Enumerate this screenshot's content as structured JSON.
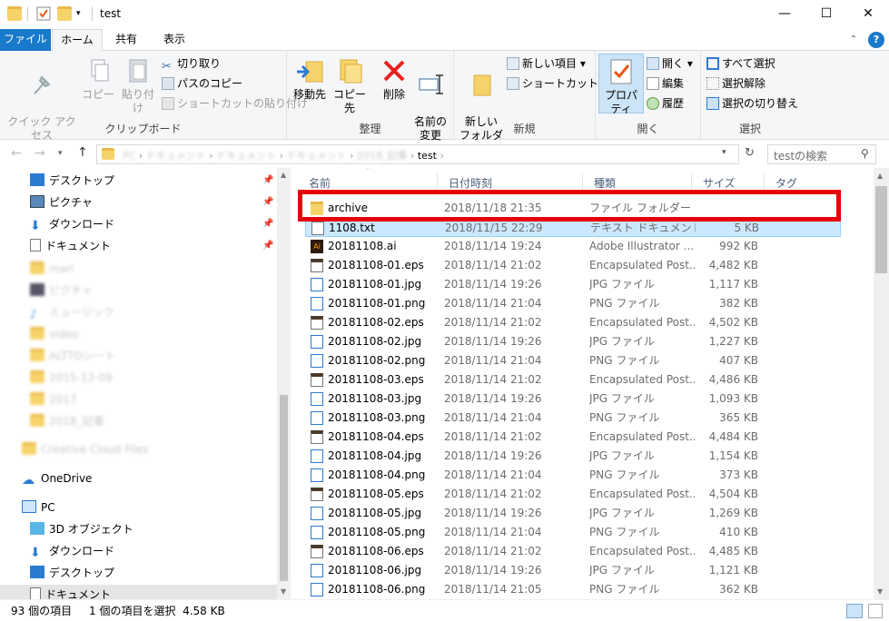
{
  "window": {
    "title": "test",
    "minimize": "—",
    "maximize": "☐",
    "close": "✕"
  },
  "tabs": {
    "file": "ファイル",
    "home": "ホーム",
    "share": "共有",
    "view": "表示"
  },
  "ribbon": {
    "clipboard": {
      "label": "クリップボード",
      "pin": "クイック アクセス\nにピン留めする",
      "copy": "コピー",
      "paste": "貼り付け",
      "cut": "切り取り",
      "copy_path": "パスのコピー",
      "paste_shortcut": "ショートカットの貼り付け"
    },
    "organize": {
      "label": "整理",
      "move_to": "移動先",
      "copy_to": "コピー先",
      "delete": "削除",
      "rename": "名前の\n変更"
    },
    "new": {
      "label": "新規",
      "new_folder": "新しい\nフォルダー",
      "new_item": "新しい項目",
      "shortcut": "ショートカット"
    },
    "open": {
      "label": "開く",
      "properties": "プロパティ",
      "open": "開く",
      "edit": "編集",
      "history": "履歴"
    },
    "select": {
      "label": "選択",
      "select_all": "すべて選択",
      "select_none": "選択解除",
      "invert": "選択の切り替え"
    }
  },
  "address": {
    "path": [
      "PC",
      "ドキュメント",
      "ドキュメント",
      "ドキュメント",
      "2018_記事",
      "test"
    ],
    "search_placeholder": "testの検索"
  },
  "nav": {
    "quick": [
      {
        "label": "デスクトップ",
        "icon": "desktop-icon"
      },
      {
        "label": "ピクチャ",
        "icon": "pictures-icon"
      },
      {
        "label": "ダウンロード",
        "icon": "download-icon"
      },
      {
        "label": "ドキュメント",
        "icon": "document-icon"
      }
    ],
    "blurred": [
      "mari",
      "ピクチャ",
      "ミュージック",
      "video",
      "ALTTOシート",
      "2015-12-09",
      "2017",
      "2018_記事",
      "Creative Cloud Files"
    ],
    "onedrive": "OneDrive",
    "pc": "PC",
    "pc_items": [
      {
        "label": "3D オブジェクト",
        "icon": "3d-objects-icon"
      },
      {
        "label": "ダウンロード",
        "icon": "download-icon"
      },
      {
        "label": "デスクトップ",
        "icon": "desktop-icon"
      },
      {
        "label": "ドキュメント",
        "icon": "document-icon"
      }
    ]
  },
  "columns": {
    "name": "名前",
    "date": "日付時刻",
    "type": "種類",
    "size": "サイズ",
    "tag": "タグ"
  },
  "files": [
    {
      "name": "archive",
      "date": "2018/11/18 21:35",
      "type": "ファイル フォルダー",
      "size": "",
      "icon": "folder-icon",
      "highlight": true
    },
    {
      "name": "1108.txt",
      "date": "2018/11/15 22:29",
      "type": "テキスト ドキュメント",
      "size": "5 KB",
      "icon": "text-file-icon",
      "selected": true
    },
    {
      "name": "20181108.ai",
      "date": "2018/11/14 19:24",
      "type": "Adobe Illustrator ...",
      "size": "992 KB",
      "icon": "ai-file-icon"
    },
    {
      "name": "20181108-01.eps",
      "date": "2018/11/14 21:02",
      "type": "Encapsulated Post...",
      "size": "4,482 KB",
      "icon": "eps-file-icon"
    },
    {
      "name": "20181108-01.jpg",
      "date": "2018/11/14 19:26",
      "type": "JPG ファイル",
      "size": "1,117 KB",
      "icon": "image-file-icon"
    },
    {
      "name": "20181108-01.png",
      "date": "2018/11/14 21:04",
      "type": "PNG ファイル",
      "size": "382 KB",
      "icon": "image-file-icon"
    },
    {
      "name": "20181108-02.eps",
      "date": "2018/11/14 21:02",
      "type": "Encapsulated Post...",
      "size": "4,502 KB",
      "icon": "eps-file-icon"
    },
    {
      "name": "20181108-02.jpg",
      "date": "2018/11/14 19:26",
      "type": "JPG ファイル",
      "size": "1,227 KB",
      "icon": "image-file-icon"
    },
    {
      "name": "20181108-02.png",
      "date": "2018/11/14 21:04",
      "type": "PNG ファイル",
      "size": "407 KB",
      "icon": "image-file-icon"
    },
    {
      "name": "20181108-03.eps",
      "date": "2018/11/14 21:02",
      "type": "Encapsulated Post...",
      "size": "4,486 KB",
      "icon": "eps-file-icon"
    },
    {
      "name": "20181108-03.jpg",
      "date": "2018/11/14 19:26",
      "type": "JPG ファイル",
      "size": "1,093 KB",
      "icon": "image-file-icon"
    },
    {
      "name": "20181108-03.png",
      "date": "2018/11/14 21:04",
      "type": "PNG ファイル",
      "size": "365 KB",
      "icon": "image-file-icon"
    },
    {
      "name": "20181108-04.eps",
      "date": "2018/11/14 21:02",
      "type": "Encapsulated Post...",
      "size": "4,484 KB",
      "icon": "eps-file-icon"
    },
    {
      "name": "20181108-04.jpg",
      "date": "2018/11/14 19:26",
      "type": "JPG ファイル",
      "size": "1,154 KB",
      "icon": "image-file-icon"
    },
    {
      "name": "20181108-04.png",
      "date": "2018/11/14 21:04",
      "type": "PNG ファイル",
      "size": "373 KB",
      "icon": "image-file-icon"
    },
    {
      "name": "20181108-05.eps",
      "date": "2018/11/14 21:02",
      "type": "Encapsulated Post...",
      "size": "4,504 KB",
      "icon": "eps-file-icon"
    },
    {
      "name": "20181108-05.jpg",
      "date": "2018/11/14 19:26",
      "type": "JPG ファイル",
      "size": "1,269 KB",
      "icon": "image-file-icon"
    },
    {
      "name": "20181108-05.png",
      "date": "2018/11/14 21:04",
      "type": "PNG ファイル",
      "size": "410 KB",
      "icon": "image-file-icon"
    },
    {
      "name": "20181108-06.eps",
      "date": "2018/11/14 21:02",
      "type": "Encapsulated Post...",
      "size": "4,485 KB",
      "icon": "eps-file-icon"
    },
    {
      "name": "20181108-06.jpg",
      "date": "2018/11/14 19:26",
      "type": "JPG ファイル",
      "size": "1,121 KB",
      "icon": "image-file-icon"
    },
    {
      "name": "20181108-06.png",
      "date": "2018/11/14 21:05",
      "type": "PNG ファイル",
      "size": "362 KB",
      "icon": "image-file-icon"
    }
  ],
  "status": {
    "count": "93 個の項目",
    "selection": "1 個の項目を選択  4.58 KB"
  },
  "colors": {
    "accent": "#1979ca",
    "selection": "#cce8ff",
    "highlight_box": "#e8000b"
  }
}
